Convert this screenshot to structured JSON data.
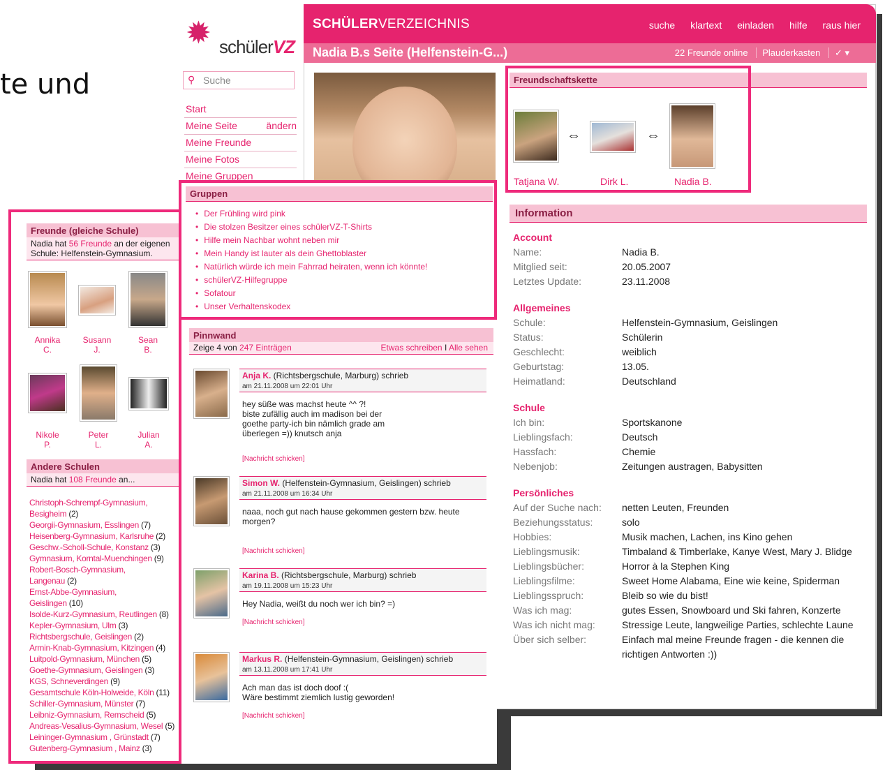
{
  "slide_text": "te und",
  "logo": {
    "text_plain": "schüler",
    "text_bold": "VZ"
  },
  "header": {
    "brand_bold": "SCHÜLER",
    "brand_rest": "VERZEICHNIS",
    "nav": [
      "suche",
      "klartext",
      "einladen",
      "hilfe",
      "raus hier"
    ],
    "page_title": "Nadia B.s Seite (Helfenstein-G...)",
    "friends_online": "22 Freunde online",
    "chat": "Plauderkasten",
    "status_icon": "✓ ▾"
  },
  "search": {
    "placeholder": "Suche"
  },
  "leftnav": [
    {
      "label": "Start"
    },
    {
      "label": "Meine Seite",
      "edit": "ändern"
    },
    {
      "label": "Meine Freunde"
    },
    {
      "label": "Meine Fotos"
    },
    {
      "label": "Meine Gruppen"
    }
  ],
  "chain": {
    "title": "Freundschaftskette",
    "arrow": "⇔",
    "people": [
      "Tatjana W.",
      "Dirk L.",
      "Nadia B."
    ]
  },
  "info": {
    "title": "Information",
    "sections": [
      {
        "title": "Account",
        "rows": [
          {
            "k": "Name:",
            "v": "Nadia B."
          },
          {
            "k": "Mitglied seit:",
            "v": "20.05.2007"
          },
          {
            "k": "Letztes Update:",
            "v": "23.11.2008"
          }
        ]
      },
      {
        "title": "Allgemeines",
        "rows": [
          {
            "k": "Schule:",
            "v": "Helfenstein-Gymnasium, Geislingen",
            "link": true
          },
          {
            "k": "Status:",
            "v": "Schülerin"
          },
          {
            "k": "Geschlecht:",
            "v": "weiblich",
            "link": true
          },
          {
            "k": "Geburtstag:",
            "v": "13.05.",
            "link": true
          },
          {
            "k": "Heimatland:",
            "v": "Deutschland",
            "link": true
          }
        ]
      },
      {
        "title": "Schule",
        "rows": [
          {
            "k": "Ich bin:",
            "v": "Sportskanone",
            "link": true
          },
          {
            "k": "Lieblingsfach:",
            "v": "Deutsch"
          },
          {
            "k": "Hassfach:",
            "v": "Chemie"
          },
          {
            "k": "Nebenjob:",
            "v": "Zeitungen austragen, Babysitten"
          }
        ]
      },
      {
        "title": "Persönliches",
        "rows": [
          {
            "k": "Auf der Suche nach:",
            "v": "netten Leuten, Freunden",
            "link": true
          },
          {
            "k": "Beziehungsstatus:",
            "v": "solo",
            "link": true
          },
          {
            "k": "Hobbies:",
            "v": "Musik machen, Lachen, ins Kino gehen"
          },
          {
            "k": "Lieblingsmusik:",
            "v": "Timbaland & Timberlake, Kanye West, Mary J. Blidge"
          },
          {
            "k": "Lieblingsbücher:",
            "v": "Horror à la Stephen King"
          },
          {
            "k": "Lieblingsfilme:",
            "v": "Sweet Home Alabama, Eine wie keine, Spiderman"
          },
          {
            "k": "Lieblingsspruch:",
            "v": "Bleib so wie du bist!"
          },
          {
            "k": "Was ich mag:",
            "v": "gutes Essen, Snowboard und Ski fahren, Konzerte"
          },
          {
            "k": "Was ich nicht mag:",
            "v": "Stressige Leute, langweilige Parties, schlechte Laune"
          },
          {
            "k": "Über sich selber:",
            "v": "Einfach mal meine Freunde fragen - die kennen die"
          },
          {
            "k": "",
            "v": "richtigen Antworten :))"
          }
        ]
      }
    ]
  },
  "groups": {
    "title": "Gruppen",
    "items": [
      "Der Frühling wird pink",
      "Die stolzen Besitzer eines schülerVZ-T-Shirts",
      "Hilfe mein Nachbar wohnt neben mir",
      "Mein Handy ist lauter als dein Ghettoblaster",
      "Natürlich würde ich mein Fahrrad heiraten, wenn ich könnte!",
      "schülerVZ-Hilfegruppe",
      "Sofatour",
      "Unser Verhaltenskodex"
    ]
  },
  "pinnwand": {
    "title": "Pinnwand",
    "show_prefix": "Zeige 4 von ",
    "count_link": "247 Einträgen",
    "write": "Etwas schreiben",
    "sep": "I",
    "all": "Alle sehen",
    "send_label": "[Nachricht schicken]",
    "posts": [
      {
        "name": "Anja K.",
        "school": " (Richtsbergschule, Marburg) schrieb",
        "date": "am 21.11.2008 um 22:01 Uhr",
        "text": "hey süße was machst heute ^^ ?!\nbiste zufällig auch im madison bei der\ngoethe party-ich bin nämlich grade am\nüberlegen =)) knutsch anja"
      },
      {
        "name": "Simon W.",
        "school": " (Helfenstein-Gymnasium, Geislingen) schrieb",
        "date": "am 21.11.2008 um 16:34 Uhr",
        "text": "naaa, noch gut nach hause gekommen gestern bzw. heute\nmorgen?"
      },
      {
        "name": "Karina B.",
        "school": " (Richtsbergschule, Marburg) schrieb",
        "date": "am 19.11.2008 um 15:23 Uhr",
        "text": "Hey Nadia, weißt du noch wer ich bin? =)"
      },
      {
        "name": "Markus R.",
        "school": " (Helfenstein-Gymnasium, Geislingen) schrieb",
        "date": "am 13.11.2008 um 17:41 Uhr",
        "text": "Ach man das ist doch doof :(\nWäre bestimmt ziemlich lustig geworden!"
      }
    ]
  },
  "friends": {
    "title": "Freunde (gleiche Schule)",
    "intro_pre": "Nadia hat ",
    "intro_link": "56 Freunde",
    "intro_post": " an der eigenen",
    "intro_line2": "Schule: Helfenstein-Gymnasium.",
    "people": [
      {
        "first": "Annika",
        "last": "C."
      },
      {
        "first": "Susann",
        "last": "J."
      },
      {
        "first": "Sean",
        "last": "B."
      },
      {
        "first": "Nikole",
        "last": "P."
      },
      {
        "first": "Peter",
        "last": "L."
      },
      {
        "first": "Julian",
        "last": "A."
      }
    ]
  },
  "other_schools": {
    "title": "Andere Schulen",
    "intro_pre": "Nadia hat ",
    "intro_link": "108 Freunde",
    "intro_post": " an...",
    "lines": [
      {
        "t": "Christoph-Schrempf-Gymnasium,",
        "c": ""
      },
      {
        "t": "Besigheim",
        "c": " (2)"
      },
      {
        "t": "Georgii-Gymnasium, Esslingen",
        "c": " (7)"
      },
      {
        "t": "Heisenberg-Gymnasium, Karlsruhe",
        "c": " (2)"
      },
      {
        "t": "Geschw.-Scholl-Schule, Konstanz",
        "c": " (3)"
      },
      {
        "t": "Gymnasium, Korntal-Muenchingen",
        "c": " (9)"
      },
      {
        "t": "Robert-Bosch-Gymnasium,",
        "c": ""
      },
      {
        "t": "Langenau",
        "c": " (2)"
      },
      {
        "t": "Ernst-Abbe-Gymnasium,",
        "c": ""
      },
      {
        "t": "Geislingen",
        "c": " (10)"
      },
      {
        "t": "Isolde-Kurz-Gymnasium, Reutlingen",
        "c": " (8)"
      },
      {
        "t": "Kepler-Gymnasium, Ulm",
        "c": " (3)"
      },
      {
        "t": "Richtsbergschule, Geislingen",
        "c": " (2)"
      },
      {
        "t": "Armin-Knab-Gymnasium, Kitzingen",
        "c": " (4)"
      },
      {
        "t": "Luitpold-Gymnasium, München",
        "c": " (5)"
      },
      {
        "t": "Goethe-Gymnasium, Geislingen",
        "c": " (3)"
      },
      {
        "t": "KGS, Schneverdingen",
        "c": " (9)"
      },
      {
        "t": "Gesamtschule Köln-Holweide, Köln",
        "c": " (11)"
      },
      {
        "t": "Schiller-Gymnasium, Münster",
        "c": " (7)"
      },
      {
        "t": "Leibniz-Gymnasium, Remscheid",
        "c": " (5)"
      },
      {
        "t": "Andreas-Vesalius-Gymnasium, Wesel",
        "c": " (5)"
      },
      {
        "t": "Leininger-Gymnasium , Grünstadt",
        "c": " (7)"
      },
      {
        "t": "Gutenberg-Gymnasium , Mainz",
        "c": " (3)"
      }
    ]
  },
  "colors": {
    "accent": "#e6236e",
    "accent_light": "#f7c1d3",
    "subbar": "#ed6c96",
    "highlight": "#ee2a7b"
  }
}
